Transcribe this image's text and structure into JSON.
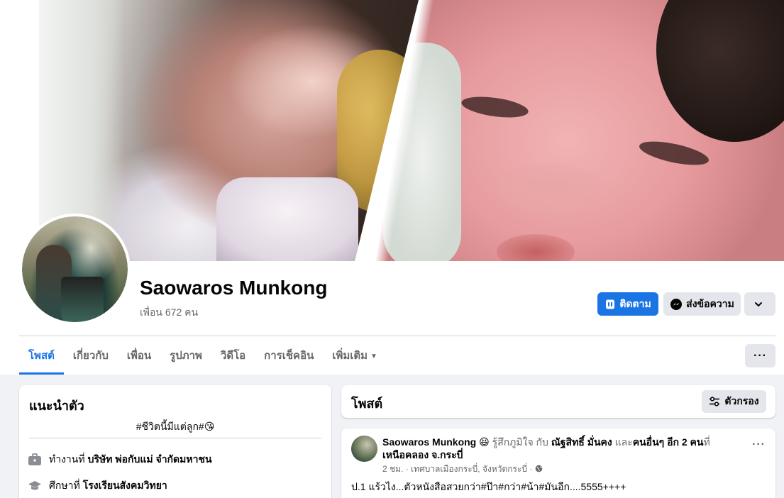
{
  "profile": {
    "name": "Saowaros Munkong",
    "friends": "เพื่อน 672 คน"
  },
  "actions": {
    "follow": "ติดตาม",
    "message": "ส่งข้อความ"
  },
  "tabs": [
    {
      "label": "โพสต์",
      "active": true
    },
    {
      "label": "เกี่ยวกับ"
    },
    {
      "label": "เพื่อน"
    },
    {
      "label": "รูปภาพ"
    },
    {
      "label": "วิดีโอ"
    },
    {
      "label": "การเช็คอิน"
    },
    {
      "label": "เพิ่มเติม"
    }
  ],
  "intro": {
    "title": "แนะนำตัว",
    "bio": "#ชีวิตนี้มีแต่ลูก#😘",
    "work_prefix": "ทำงานที่",
    "work_place": "บริษัท พ่อกับแม่ จำกัดมหาชน",
    "study_prefix": "ศึกษาที่",
    "study_place": "โรงเรียนสังคมวิทยา"
  },
  "posts_header": {
    "title": "โพสต์",
    "filter": "ตัวกรอง"
  },
  "post": {
    "author": "Saowaros Munkong",
    "emoji": "😆",
    "feeling": "รู้สึกภูมิใจ กับ",
    "tagged": "ณัฐสิทธิ์ มั่นคง",
    "and": "และ",
    "others": "คนอื่นๆ อีก 2 คน",
    "at": "ที่",
    "place": "เหนือคลอง จ.กระบี่",
    "meta": "2 ชม. · เทศบาลเมืองกระบี่, จังหวัดกระบี่ ·",
    "text": "ป.1 แร้วไง...ตัวหนังสือสวยกว่า#ป๊า#กว่า#น้า#มันอีก....5555++++"
  },
  "colors": {
    "accent": "#1b74e4",
    "background": "#f0f2f5",
    "muted_text": "#65676b",
    "button_gray": "#e4e6eb"
  }
}
